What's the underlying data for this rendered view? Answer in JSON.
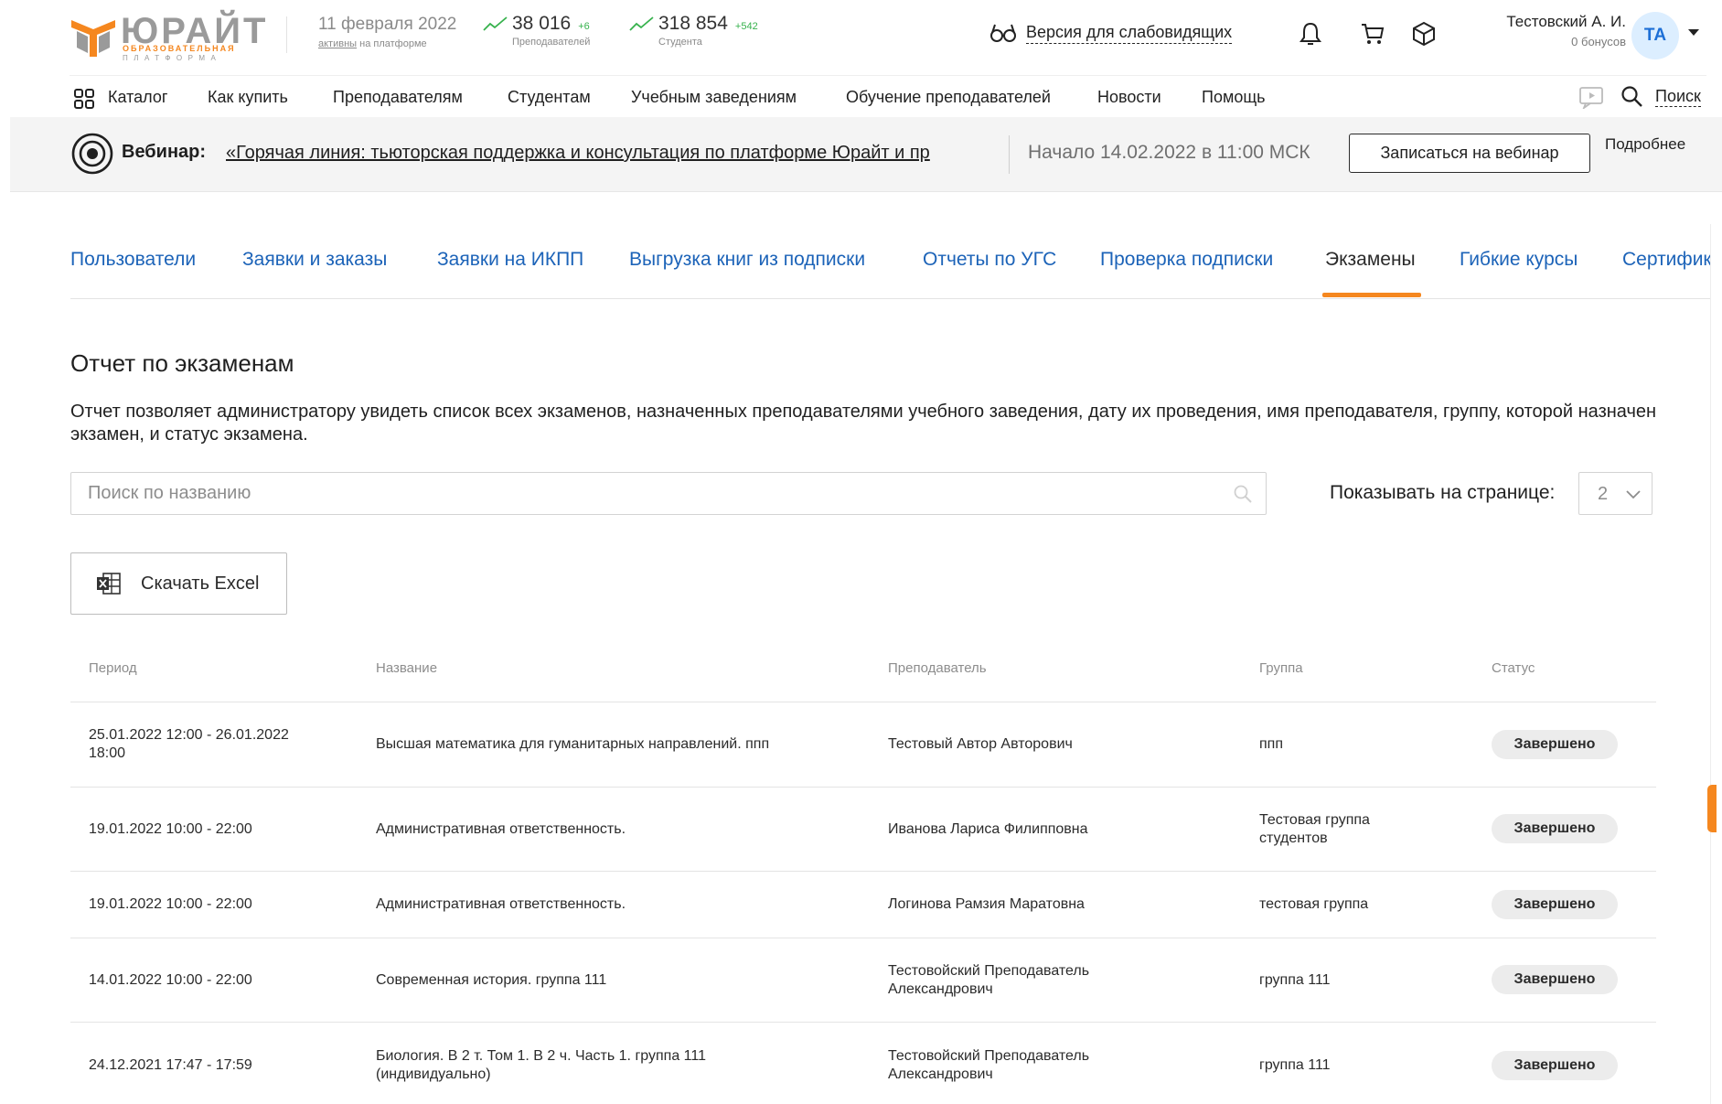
{
  "header": {
    "logo": {
      "title": "ЮРАЙТ",
      "subtitle_1": "ОБРАЗОВАТЕЛЬНАЯ",
      "subtitle_2": "ПЛАТФОРМА"
    },
    "date": "11 февраля 2022",
    "active_link": "активны",
    "active_text": "на платформе",
    "stats": [
      {
        "value": "38 016",
        "delta": "+6",
        "label": "Преподавателей"
      },
      {
        "value": "318 854",
        "delta": "+542",
        "label": "Студента"
      }
    ],
    "vision_label": "Версия для слабовидящих",
    "icons": [
      "bell-icon",
      "cart-icon",
      "box-icon"
    ],
    "user": {
      "name": "Тестовский А. И.",
      "bonus": "0 бонусов",
      "initials": "ТА"
    }
  },
  "nav": {
    "items": [
      "Каталог",
      "Как купить",
      "Преподавателям",
      "Студентам",
      "Учебным заведениям",
      "Обучение преподавателей",
      "Новости",
      "Помощь"
    ],
    "search_label": "Поиск"
  },
  "webinar": {
    "label": "Вебинар:",
    "title": "«Горячая линия: тьюторская поддержка и консультация по платформе Юрайт и пр",
    "date": "Начало 14.02.2022 в 11:00 МСК",
    "register_button": "Записаться на вебинар",
    "more_link": "Подробнее"
  },
  "tabs": {
    "items": [
      "Пользователи",
      "Заявки и заказы",
      "Заявки на ИКПП",
      "Выгрузка книг из подписки",
      "Отчеты по УГС",
      "Проверка подписки",
      "Экзамены",
      "Гибкие курсы",
      "Сертифика"
    ],
    "active": "Экзамены"
  },
  "report": {
    "title": "Отчет по экзаменам",
    "description": "Отчет позволяет администратору увидеть список всех экзаменов, назначенных преподавателями учебного заведения, дату их проведения, имя преподавателя, группу, которой назначен экзамен, и статус экзамена.",
    "search_placeholder": "Поиск по названию",
    "per_page_label": "Показывать на странице:",
    "per_page_value": "2",
    "excel_button": "Скачать Excel"
  },
  "table": {
    "columns": [
      "Период",
      "Название",
      "Преподаватель",
      "Группа",
      "Статус"
    ],
    "rows": [
      {
        "period": "25.01.2022 12:00 - 26.01.2022 18:00",
        "name": "Высшая математика для гуманитарных направлений. ппп",
        "teacher": "Тестовый Автор Авторович",
        "group": "ппп",
        "status": "Завершено"
      },
      {
        "period": "19.01.2022 10:00 - 22:00",
        "name": "Административная ответственность.",
        "teacher": "Иванова Лариса Филипповна",
        "group": "Тестовая группа студентов",
        "status": "Завершено"
      },
      {
        "period": "19.01.2022 10:00 - 22:00",
        "name": "Административная ответственность.",
        "teacher": "Логинова Рамзия Маратовна",
        "group": "тестовая группа",
        "status": "Завершено"
      },
      {
        "period": "14.01.2022 10:00 - 22:00",
        "name": "Современная история. группа 111",
        "teacher": "Тестовойский Преподаватель Александрович",
        "group": "группа 111",
        "status": "Завершено"
      },
      {
        "period": "24.12.2021 17:47 - 17:59",
        "name": "Биология. В 2 т. Том 1. В 2 ч. Часть 1. группа 111 (индивидуально)",
        "teacher": "Тестовойский Преподаватель Александрович",
        "group": "группа 111",
        "status": "Завершено"
      }
    ]
  },
  "colors": {
    "accent": "#f5871f",
    "link": "#1c63b8",
    "trend_green": "#37b24d",
    "avatar_bg": "#dceeff",
    "avatar_text": "#1d6fd6",
    "badge_bg": "#ececec"
  }
}
